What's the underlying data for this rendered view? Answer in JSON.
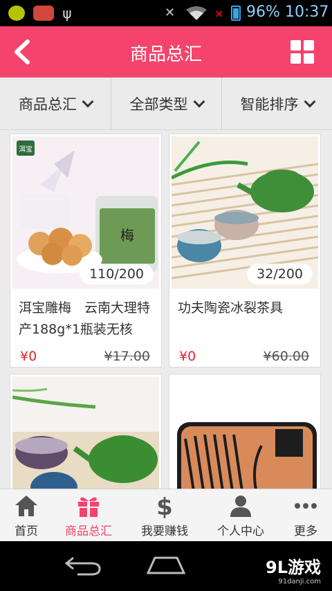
{
  "status_bar": {
    "battery": "96%",
    "time": "10:37"
  },
  "header": {
    "title": "商品总汇"
  },
  "filters": [
    {
      "label": "商品总汇"
    },
    {
      "label": "全部类型"
    },
    {
      "label": "智能排序"
    }
  ],
  "products": [
    {
      "name": "洱宝雕梅　云南大理特产188g*1瓶装无核",
      "stock": "110/200",
      "price": "¥0",
      "original_price": "¥17.00",
      "image_label": "洱宝"
    },
    {
      "name": "功夫陶瓷冰裂茶具",
      "stock": "32/200",
      "price": "¥0",
      "original_price": "¥60.00"
    },
    {
      "name": "",
      "stock": "",
      "price": "",
      "original_price": ""
    },
    {
      "name": "",
      "stock": "",
      "price": "",
      "original_price": ""
    }
  ],
  "tabs": [
    {
      "label": "首页",
      "icon": "home-icon"
    },
    {
      "label": "商品总汇",
      "icon": "gift-icon"
    },
    {
      "label": "我要赚钱",
      "icon": "dollar-icon"
    },
    {
      "label": "个人中心",
      "icon": "person-icon"
    },
    {
      "label": "更多",
      "icon": "more-icon"
    }
  ],
  "watermark": {
    "brand": "9L游戏",
    "url": "91danji.com"
  },
  "colors": {
    "accent": "#f4436c",
    "price": "#e8232b"
  }
}
